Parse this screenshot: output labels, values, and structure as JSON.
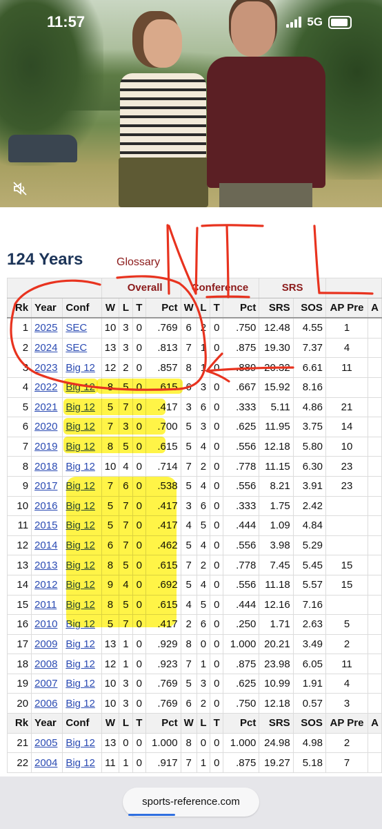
{
  "status_bar": {
    "time": "11:57",
    "network": "5G"
  },
  "video": {
    "mute_icon": "speaker-muted-icon"
  },
  "page": {
    "heading": "124 Years",
    "glossary_link": "Glossary"
  },
  "table": {
    "groups": {
      "overall": "Overall",
      "conference": "Conference",
      "srs": "SRS"
    },
    "headers": [
      "Rk",
      "Year",
      "Conf",
      "W",
      "L",
      "T",
      "Pct",
      "W",
      "L",
      "T",
      "Pct",
      "SRS",
      "SOS",
      "AP Pre",
      "A"
    ],
    "rows": [
      [
        "1",
        "2025",
        "SEC",
        "10",
        "3",
        "0",
        ".769",
        "6",
        "2",
        "0",
        ".750",
        "12.48",
        "4.55",
        "1"
      ],
      [
        "2",
        "2024",
        "SEC",
        "13",
        "3",
        "0",
        ".813",
        "7",
        "1",
        "0",
        ".875",
        "19.30",
        "7.37",
        "4"
      ],
      [
        "3",
        "2023",
        "Big 12",
        "12",
        "2",
        "0",
        ".857",
        "8",
        "1",
        "0",
        ".889",
        "20.32",
        "6.61",
        "11"
      ],
      [
        "4",
        "2022",
        "Big 12",
        "8",
        "5",
        "0",
        ".615",
        "6",
        "3",
        "0",
        ".667",
        "15.92",
        "8.16",
        ""
      ],
      [
        "5",
        "2021",
        "Big 12",
        "5",
        "7",
        "0",
        ".417",
        "3",
        "6",
        "0",
        ".333",
        "5.11",
        "4.86",
        "21"
      ],
      [
        "6",
        "2020",
        "Big 12",
        "7",
        "3",
        "0",
        ".700",
        "5",
        "3",
        "0",
        ".625",
        "11.95",
        "3.75",
        "14"
      ],
      [
        "7",
        "2019",
        "Big 12",
        "8",
        "5",
        "0",
        ".615",
        "5",
        "4",
        "0",
        ".556",
        "12.18",
        "5.80",
        "10"
      ],
      [
        "8",
        "2018",
        "Big 12",
        "10",
        "4",
        "0",
        ".714",
        "7",
        "2",
        "0",
        ".778",
        "11.15",
        "6.30",
        "23"
      ],
      [
        "9",
        "2017",
        "Big 12",
        "7",
        "6",
        "0",
        ".538",
        "5",
        "4",
        "0",
        ".556",
        "8.21",
        "3.91",
        "23"
      ],
      [
        "10",
        "2016",
        "Big 12",
        "5",
        "7",
        "0",
        ".417",
        "3",
        "6",
        "0",
        ".333",
        "1.75",
        "2.42",
        ""
      ],
      [
        "11",
        "2015",
        "Big 12",
        "5",
        "7",
        "0",
        ".417",
        "4",
        "5",
        "0",
        ".444",
        "1.09",
        "4.84",
        ""
      ],
      [
        "12",
        "2014",
        "Big 12",
        "6",
        "7",
        "0",
        ".462",
        "5",
        "4",
        "0",
        ".556",
        "3.98",
        "5.29",
        ""
      ],
      [
        "13",
        "2013",
        "Big 12",
        "8",
        "5",
        "0",
        ".615",
        "7",
        "2",
        "0",
        ".778",
        "7.45",
        "5.45",
        "15"
      ],
      [
        "14",
        "2012",
        "Big 12",
        "9",
        "4",
        "0",
        ".692",
        "5",
        "4",
        "0",
        ".556",
        "11.18",
        "5.57",
        "15"
      ],
      [
        "15",
        "2011",
        "Big 12",
        "8",
        "5",
        "0",
        ".615",
        "4",
        "5",
        "0",
        ".444",
        "12.16",
        "7.16",
        ""
      ],
      [
        "16",
        "2010",
        "Big 12",
        "5",
        "7",
        "0",
        ".417",
        "2",
        "6",
        "0",
        ".250",
        "1.71",
        "2.63",
        "5"
      ],
      [
        "17",
        "2009",
        "Big 12",
        "13",
        "1",
        "0",
        ".929",
        "8",
        "0",
        "0",
        "1.000",
        "20.21",
        "3.49",
        "2"
      ],
      [
        "18",
        "2008",
        "Big 12",
        "12",
        "1",
        "0",
        ".923",
        "7",
        "1",
        "0",
        ".875",
        "23.98",
        "6.05",
        "11"
      ],
      [
        "19",
        "2007",
        "Big 12",
        "10",
        "3",
        "0",
        ".769",
        "5",
        "3",
        "0",
        ".625",
        "10.99",
        "1.91",
        "4"
      ],
      [
        "20",
        "2006",
        "Big 12",
        "10",
        "3",
        "0",
        ".769",
        "6",
        "2",
        "0",
        ".750",
        "12.18",
        "0.57",
        "3"
      ]
    ],
    "rows_after_repeat": [
      [
        "21",
        "2005",
        "Big 12",
        "13",
        "0",
        "0",
        "1.000",
        "8",
        "0",
        "0",
        "1.000",
        "24.98",
        "4.98",
        "2"
      ],
      [
        "22",
        "2004",
        "Big 12",
        "11",
        "1",
        "0",
        ".917",
        "7",
        "1",
        "0",
        ".875",
        "19.27",
        "5.18",
        "7"
      ]
    ]
  },
  "annotations": {
    "handwritten_text": "NIL",
    "highlight_color": "#fff000",
    "ink_color": "#e8331f"
  },
  "browser": {
    "url": "sports-reference.com"
  }
}
